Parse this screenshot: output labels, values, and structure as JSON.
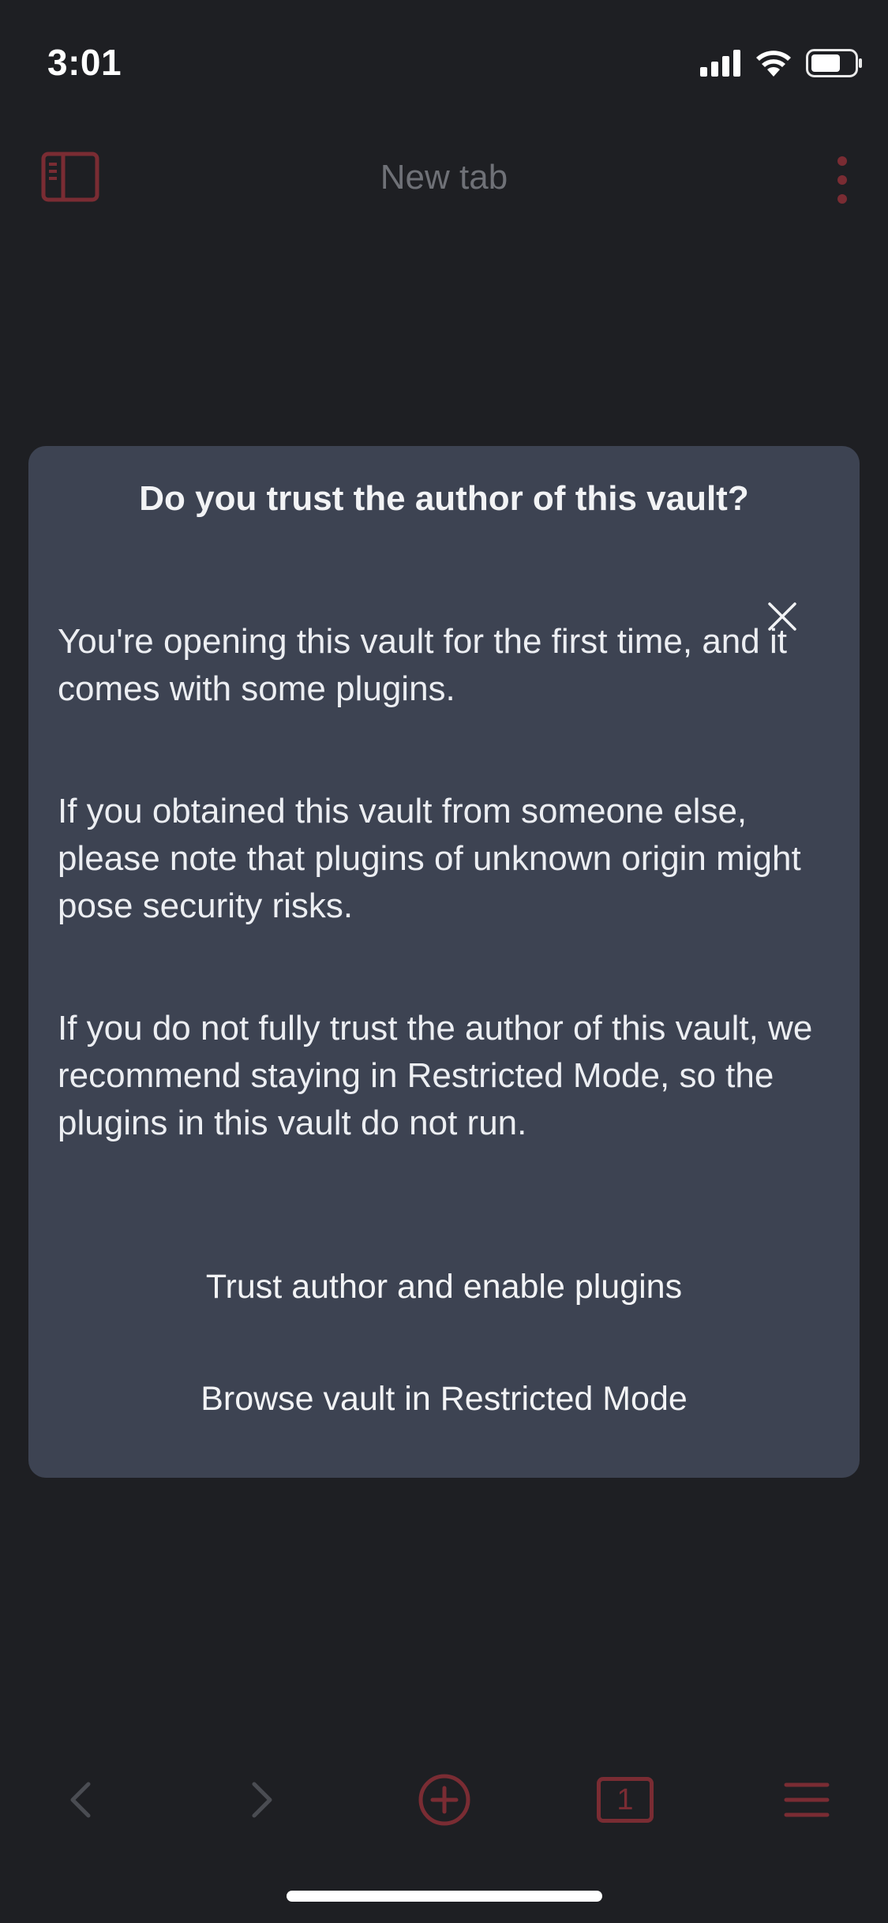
{
  "status_bar": {
    "time": "3:01",
    "icons": [
      "signal-icon",
      "wifi-icon",
      "battery-icon"
    ]
  },
  "header": {
    "title": "New tab",
    "left_icon": "sidebar-toggle-icon",
    "right_icon": "more-vertical-icon"
  },
  "modal": {
    "title": "Do you trust the author of this vault?",
    "paragraphs": [
      "You're opening this vault for the first time, and it comes with some plugins.",
      "If you obtained this vault from someone else, please note that plugins of unknown origin might pose security risks.",
      "If you do not fully trust the author of this vault, we recommend staying in Restricted Mode, so the plugins in this vault do not run."
    ],
    "trust_button": "Trust author and enable plugins",
    "restricted_button": "Browse vault in Restricted Mode"
  },
  "bottom_bar": {
    "items": [
      "back-icon",
      "forward-icon",
      "new-tab-icon",
      "tab-count-icon",
      "menu-icon"
    ],
    "tab_count": "1"
  },
  "colors": {
    "background": "#1e1f23",
    "modal_bg": "#3d4352",
    "accent": "#8a2f38",
    "text": "#eceef2"
  }
}
